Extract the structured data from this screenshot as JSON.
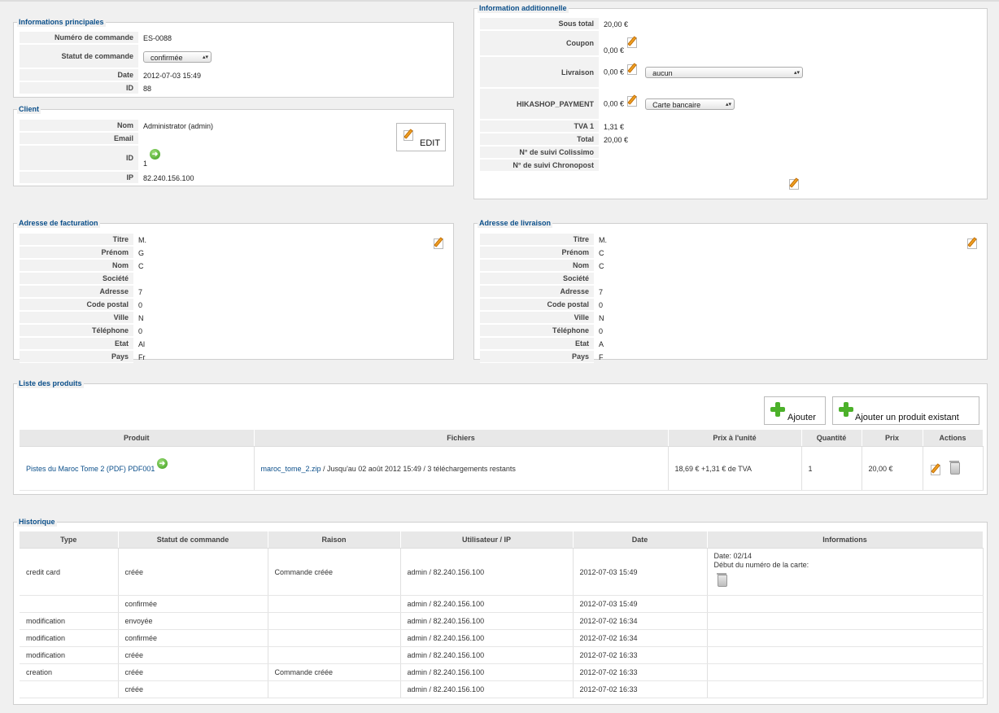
{
  "main_info": {
    "legend": "Informations principales",
    "order_number_label": "Numéro de commande",
    "order_number": "ES-0088",
    "status_label": "Statut de commande",
    "status": "confirmée",
    "date_label": "Date",
    "date": "2012-07-03 15:49",
    "id_label": "ID",
    "id": "88"
  },
  "client": {
    "legend": "Client",
    "nom_label": "Nom",
    "nom": "Administrator (admin)",
    "email_label": "Email",
    "email": "",
    "id_label": "ID",
    "id": "1",
    "ip_label": "IP",
    "ip": "82.240.156.100",
    "edit_label": "EDIT"
  },
  "additional": {
    "legend": "Information additionnelle",
    "subtotal_label": "Sous total",
    "subtotal": "20,00 €",
    "coupon_label": "Coupon",
    "coupon": "0,00 €",
    "shipping_label": "Livraison",
    "shipping": "0,00 €",
    "shipping_select": "aucun",
    "payment_label": "HIKASHOP_PAYMENT",
    "payment": "0,00 €",
    "payment_select": "Carte bancaire",
    "tva_label": "TVA 1",
    "tva": "1,31 €",
    "total_label": "Total",
    "total": "20,00 €",
    "colissimo_label": "N° de suivi Colissimo",
    "chronopost_label": "N° de suivi Chronopost"
  },
  "billing": {
    "legend": "Adresse de facturation",
    "labels": [
      "Titre",
      "Prénom",
      "Nom",
      "Société",
      "Adresse",
      "Code postal",
      "Ville",
      "Téléphone",
      "Etat",
      "Pays"
    ],
    "values": [
      "M.",
      "G",
      "C",
      "",
      "7",
      "0 ",
      "N",
      "0 ",
      "Al",
      "Fr"
    ]
  },
  "shipping_addr": {
    "legend": "Adresse de livraison",
    "labels": [
      "Titre",
      "Prénom",
      "Nom",
      "Société",
      "Adresse",
      "Code postal",
      "Ville",
      "Téléphone",
      "Etat",
      "Pays"
    ],
    "values": [
      "M.",
      "C",
      "C",
      "",
      "7",
      "0",
      "N",
      "0",
      "A",
      "F"
    ]
  },
  "products": {
    "legend": "Liste des produits",
    "add_label": "Ajouter",
    "add_existing_label": "Ajouter un produit existant",
    "headers": [
      "Produit",
      "Fichiers",
      "Prix à l'unité",
      "Quantité",
      "Prix",
      "Actions"
    ],
    "row": {
      "product": "Pistes du Maroc Tome 2 (PDF) PDF001",
      "file_link": "maroc_tome_2.zip",
      "file_rest": " / Jusqu'au 02 août 2012 15:49 / 3 téléchargements restants",
      "unit_price": "18,69 € +1,31 € de TVA",
      "quantity": "1",
      "price": "20,00 €"
    }
  },
  "history": {
    "legend": "Historique",
    "headers": [
      "Type",
      "Statut de commande",
      "Raison",
      "Utilisateur / IP",
      "Date",
      "Informations"
    ],
    "first_info_date": "Date: 02/14",
    "first_info_card": "Début du numéro de la carte:",
    "rows": [
      {
        "type": "credit card",
        "status": "créée",
        "reason": "Commande créée",
        "user": "admin / 82.240.156.100",
        "date": "2012-07-03 15:49"
      },
      {
        "type": "",
        "status": "confirmée",
        "reason": "",
        "user": "admin / 82.240.156.100",
        "date": "2012-07-03 15:49"
      },
      {
        "type": "modification",
        "status": "envoyée",
        "reason": "",
        "user": "admin / 82.240.156.100",
        "date": "2012-07-02 16:34"
      },
      {
        "type": "modification",
        "status": "confirmée",
        "reason": "",
        "user": "admin / 82.240.156.100",
        "date": "2012-07-02 16:34"
      },
      {
        "type": "modification",
        "status": "créée",
        "reason": "",
        "user": "admin / 82.240.156.100",
        "date": "2012-07-02 16:33"
      },
      {
        "type": "creation",
        "status": "créée",
        "reason": "Commande créée",
        "user": "admin / 82.240.156.100",
        "date": "2012-07-02 16:33"
      },
      {
        "type": "",
        "status": "créée",
        "reason": "",
        "user": "admin / 82.240.156.100",
        "date": "2012-07-02 16:33"
      }
    ]
  }
}
